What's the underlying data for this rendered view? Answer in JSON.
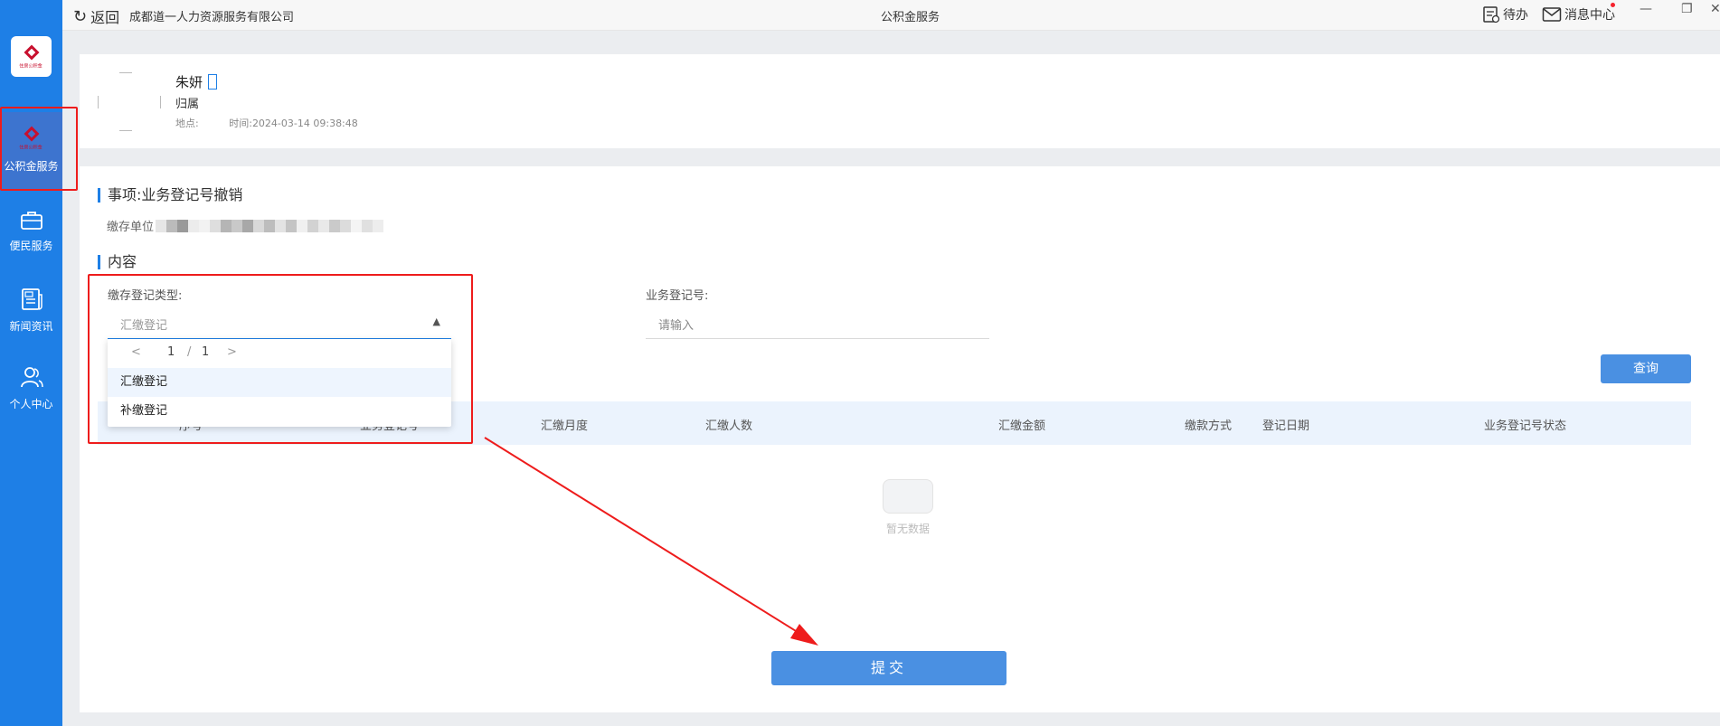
{
  "titlebar": {
    "back_label": "返回",
    "company": "成都道一人力资源服务有限公司",
    "window_title": "公积金服务",
    "todo_label": "待办",
    "message_label": "消息中心"
  },
  "sidebar": {
    "logo_text": "住房公积金",
    "items": [
      {
        "label": "公积金服务",
        "icon": "housing-fund-icon",
        "sub": "住房公积金"
      },
      {
        "label": "便民服务",
        "icon": "briefcase-icon"
      },
      {
        "label": "新闻资讯",
        "icon": "news-icon"
      },
      {
        "label": "个人中心",
        "icon": "user-icon"
      }
    ]
  },
  "profile": {
    "name": "朱妍",
    "belong": "归属",
    "location_label": "地点:",
    "time_label": "时间:",
    "time_value": "2024-03-14 09:38:48"
  },
  "matter": {
    "title": "事项:业务登记号撤销",
    "unit_label": "缴存单位"
  },
  "content": {
    "title": "内容",
    "type_label": "缴存登记类型:",
    "type_placeholder": "汇缴登记",
    "regno_label": "业务登记号:",
    "regno_placeholder": "请输入",
    "query_button": "查询",
    "submit_button": "提交"
  },
  "dropdown": {
    "pager_prev": "<",
    "page_current": "1",
    "page_sep": "/",
    "page_total": "1",
    "pager_next": ">",
    "options": [
      "汇缴登记",
      "补缴登记"
    ]
  },
  "table": {
    "headers": [
      "序号",
      "业务登记号",
      "汇缴月度",
      "汇缴人数",
      "汇缴金额",
      "缴款方式",
      "登记日期",
      "业务登记号状态"
    ]
  },
  "empty_state": {
    "text": "暂无数据"
  },
  "colors": {
    "sidebar": "#1e7fe6",
    "primary_button": "#4a90e2",
    "annotation_red": "#ee1c1c",
    "table_header": "#ebf3fd"
  }
}
